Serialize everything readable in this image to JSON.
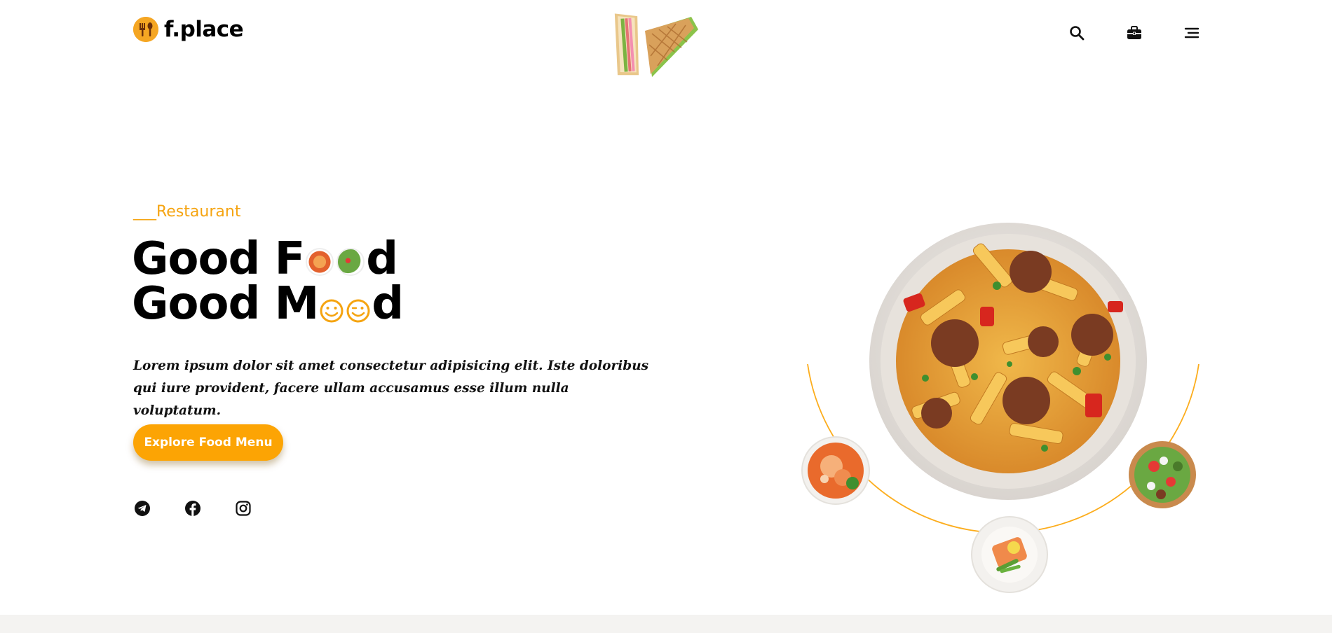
{
  "brand": {
    "name": "f.place",
    "accent": "#f5a623"
  },
  "nav": {
    "icons": [
      "search-icon",
      "briefcase-icon",
      "menu-icon"
    ]
  },
  "hero": {
    "eyebrow": "___Restaurant",
    "headline_line1_start": "Good F",
    "headline_line1_end": "d",
    "headline_line2_start": "Good M",
    "headline_line2_end": "d",
    "description": "Lorem ipsum dolor sit amet consectetur adipisicing elit. Iste doloribus qui iure provident, facere ullam accusamus esse illum nulla voluptatum.",
    "cta_label": "Explore Food Menu"
  },
  "social": [
    "telegram-icon",
    "facebook-icon",
    "instagram-icon"
  ],
  "colors": {
    "accent": "#fca404",
    "text": "#000000",
    "footer_band": "#f4f3f1"
  }
}
